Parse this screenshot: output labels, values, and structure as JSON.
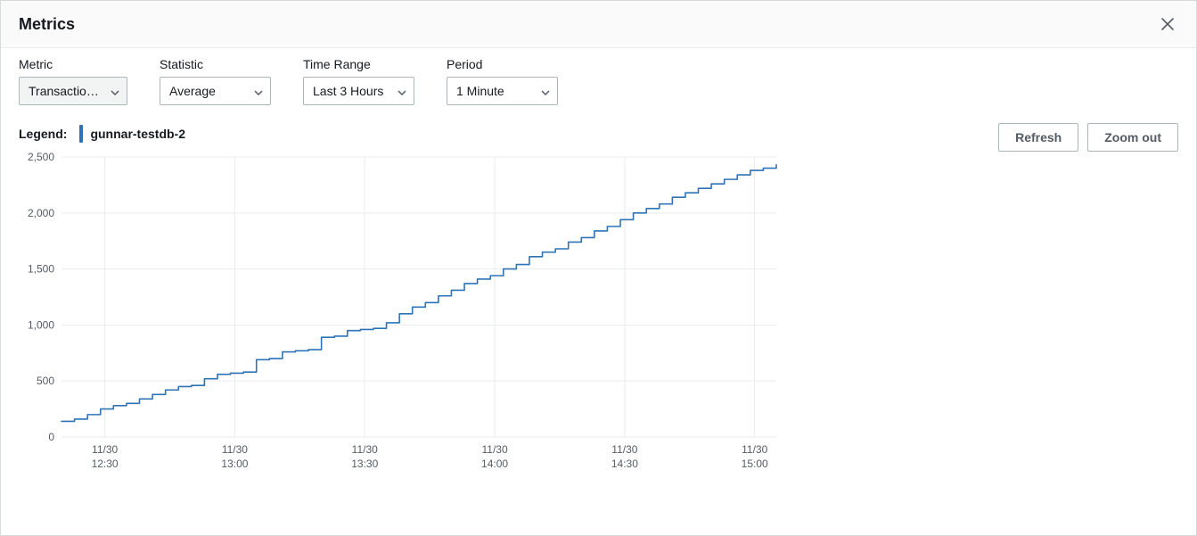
{
  "header": {
    "title": "Metrics"
  },
  "controls": {
    "metric": {
      "label": "Metric",
      "value": "Transactio…"
    },
    "statistic": {
      "label": "Statistic",
      "value": "Average"
    },
    "range": {
      "label": "Time Range",
      "value": "Last 3 Hours"
    },
    "period": {
      "label": "Period",
      "value": "1 Minute"
    }
  },
  "actions": {
    "refresh": "Refresh",
    "zoomout": "Zoom out"
  },
  "legend": {
    "label": "Legend:",
    "series": "gunnar-testdb-2",
    "color": "#2e73b8"
  },
  "chart_data": {
    "type": "line",
    "title": "",
    "xlabel": "",
    "ylabel": "",
    "ylim": [
      0,
      2500
    ],
    "y_ticks": [
      "0",
      "500",
      "1,000",
      "1,500",
      "2,000",
      "2,500"
    ],
    "x_tick_labels": [
      {
        "top": "11/30",
        "bottom": "12:30"
      },
      {
        "top": "11/30",
        "bottom": "13:00"
      },
      {
        "top": "11/30",
        "bottom": "13:30"
      },
      {
        "top": "11/30",
        "bottom": "14:00"
      },
      {
        "top": "11/30",
        "bottom": "14:30"
      },
      {
        "top": "11/30",
        "bottom": "15:00"
      }
    ],
    "series": [
      {
        "name": "gunnar-testdb-2",
        "x_minutes_from_start": [
          0,
          3,
          6,
          9,
          12,
          15,
          18,
          21,
          24,
          27,
          30,
          33,
          36,
          39,
          42,
          45,
          48,
          51,
          54,
          57,
          60,
          63,
          66,
          69,
          72,
          75,
          78,
          81,
          84,
          87,
          90,
          93,
          96,
          99,
          102,
          105,
          108,
          111,
          114,
          117,
          120,
          123,
          126,
          129,
          132,
          135,
          138,
          141,
          144,
          147,
          150,
          153,
          156,
          159,
          162,
          165
        ],
        "values": [
          140,
          160,
          200,
          250,
          280,
          300,
          340,
          380,
          420,
          450,
          460,
          520,
          560,
          570,
          580,
          690,
          700,
          760,
          770,
          780,
          890,
          900,
          950,
          960,
          970,
          1020,
          1100,
          1160,
          1200,
          1260,
          1310,
          1370,
          1410,
          1440,
          1500,
          1540,
          1610,
          1650,
          1680,
          1740,
          1780,
          1840,
          1880,
          1940,
          2000,
          2040,
          2080,
          2140,
          2180,
          2220,
          2260,
          2300,
          2340,
          2380,
          2400,
          2430
        ]
      }
    ]
  }
}
